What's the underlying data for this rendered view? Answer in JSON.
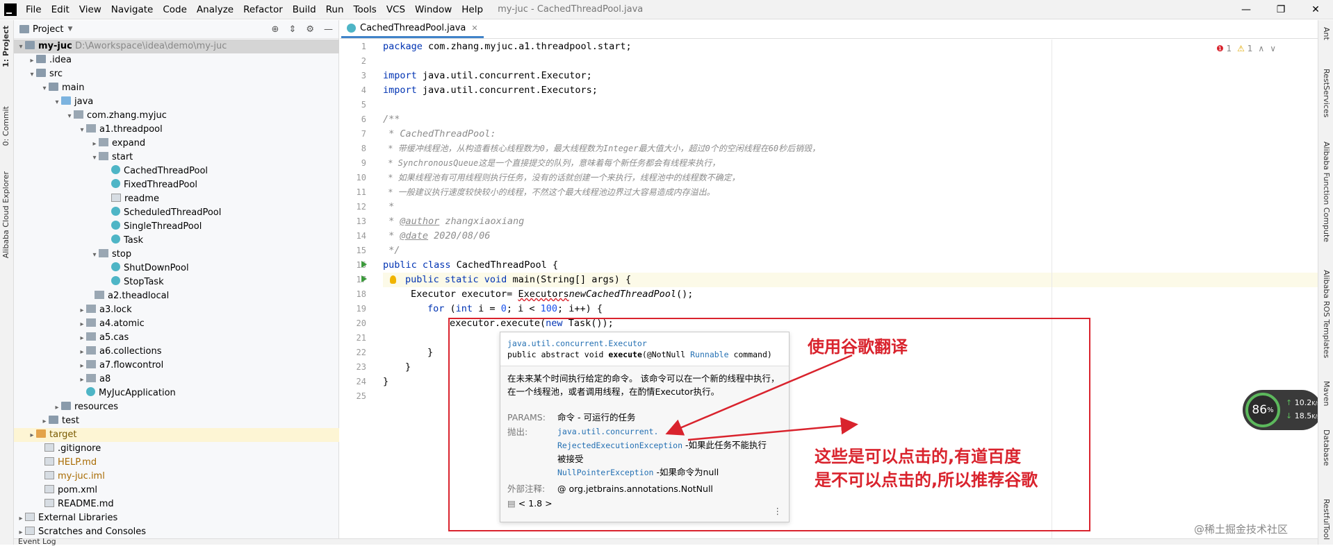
{
  "menubar": {
    "items": [
      "File",
      "Edit",
      "View",
      "Navigate",
      "Code",
      "Analyze",
      "Refactor",
      "Build",
      "Run",
      "Tools",
      "VCS",
      "Window",
      "Help"
    ],
    "title": "my-juc - CachedThreadPool.java"
  },
  "left_tools": {
    "project": "1: Project",
    "commit": "0: Commit",
    "cloud": "Alibaba Cloud Explorer"
  },
  "right_tools": {
    "ant": "Ant",
    "rest": "RestServices",
    "func": "Alibaba Function Compute",
    "ros": "Alibaba ROS Templates",
    "maven": "Maven",
    "db": "Database",
    "restf": "RestfulTool"
  },
  "project": {
    "title": "Project",
    "root_name": "my-juc",
    "root_path": "D:\\Aworkspace\\idea\\demo\\my-juc",
    "items": [
      ".idea",
      "src",
      "main",
      "java",
      "com.zhang.myjuc",
      "a1.threadpool",
      "expand",
      "start",
      "CachedThreadPool",
      "FixedThreadPool",
      "readme",
      "ScheduledThreadPool",
      "SingleThreadPool",
      "Task",
      "stop",
      "ShutDownPool",
      "StopTask",
      "a2.theadlocal",
      "a3.lock",
      "a4.atomic",
      "a5.cas",
      "a6.collections",
      "a7.flowcontrol",
      "a8",
      "MyJucApplication",
      "resources",
      "test",
      "target",
      ".gitignore",
      "HELP.md",
      "my-juc.iml",
      "pom.xml",
      "README.md",
      "External Libraries",
      "Scratches and Consoles"
    ]
  },
  "editor": {
    "tab": "CachedThreadPool.java",
    "errors": "1",
    "warnings": "1",
    "line_numbers": [
      "1",
      "2",
      "3",
      "4",
      "5",
      "6",
      "7",
      "8",
      "9",
      "10",
      "11",
      "12",
      "13",
      "14",
      "15",
      "16",
      "17",
      "18",
      "19",
      "20",
      "21",
      "22",
      "23",
      "24",
      "25"
    ],
    "code": {
      "l1a": "package ",
      "l1b": "com.zhang.myjuc.a1.threadpool.start;",
      "l3a": "import ",
      "l3b": "java.util.concurrent.Executor;",
      "l4a": "import ",
      "l4b": "java.util.concurrent.Executors;",
      "l6": "/**",
      "l7": " * CachedThreadPool:",
      "l8": " * 带缓冲线程池，从构造看核心线程数为0，最大线程数为Integer最大值大小，超过0个的空闲线程在60秒后销毁，",
      "l9": " * SynchronousQueue这是一个直接提交的队列，意味着每个新任务都会有线程来执行，",
      "l10": " * 如果线程池有可用线程则执行任务，没有的话就创建一个来执行，线程池中的线程数不确定，",
      "l11": " * 一般建议执行速度较快较小的线程，不然这个最大线程池边界过大容易造成内存溢出。",
      "l12": " *",
      "l13a": " * ",
      "l13b": "@author",
      " l13c": " zhangxiaoxiang",
      "l14a": " * ",
      "l14b": "@date",
      "l14c": " 2020/08/06",
      "l15": " */",
      "l16a": "public class ",
      "l16b": "CachedThreadPool {",
      "l17a": "public static void ",
      "l17b": "main(String[] args) {",
      "l18a": "Executor executor= ",
      "l18b": "Executors",
      ".l18c": ".",
      "l18d": "newCachedThreadPool",
      "l18e": "();",
      "l19a": "for ",
      "l19b": "(",
      "l19c": "int ",
      "l19d": "i = ",
      "l19e": "0",
      "l19f": "; i < ",
      "l19g": "100",
      "l19h": "; i++) {",
      "l20a": "executor.execute(",
      "l20b": "new ",
      "l20c": "Task());",
      "l22": "}",
      "l23": "}",
      "l24": "}"
    }
  },
  "popup": {
    "sig_pkg": "java.util.concurrent.Executor",
    "sig_a": "public abstract void ",
    "sig_b": "execute",
    "sig_c": "(@NotNull ",
    "sig_d": "Runnable",
    "sig_e": " command)",
    "desc": "在未来某个时间执行给定的命令。 该命令可以在一个新的线程中执行，在一个线程池，或者调用线程，在酌情Executor执行。",
    "params_label": "PARAMS:",
    "params_val": "命令 - 可运行的任务",
    "throws_label": "抛出:",
    "throws_pkg": "java.util.concurrent.",
    "throws_ex1": "RejectedExecutionException",
    "throws_ex1_desc": " -如果此任务不能执行",
    "throws_ex1_desc2": "被接受",
    "throws_ex2": "NullPointerException",
    "throws_ex2_desc": " -如果命令为null",
    "ext_label": "外部注释:",
    "ext_val": "@ org.jetbrains.annotations.NotNull",
    "jdk": "< 1.8 >"
  },
  "annotations": {
    "a1": "使用谷歌翻译",
    "a2": "这些是可以点击的,有道百度",
    "a3": "是不可以点击的,所以推荐谷歌"
  },
  "gauge": {
    "percent": "86",
    "unit": "%",
    "up": "10.2",
    "down": "18.5",
    "rate_unit": "K/s"
  },
  "watermark": "@稀土掘金技术社区",
  "statusbar": {
    "event_log": "Event Log"
  },
  "colors": {
    "accent": "#4083c9",
    "annotation": "#d9232d",
    "keyword": "#0033b3",
    "comment": "#8c8c8c"
  }
}
